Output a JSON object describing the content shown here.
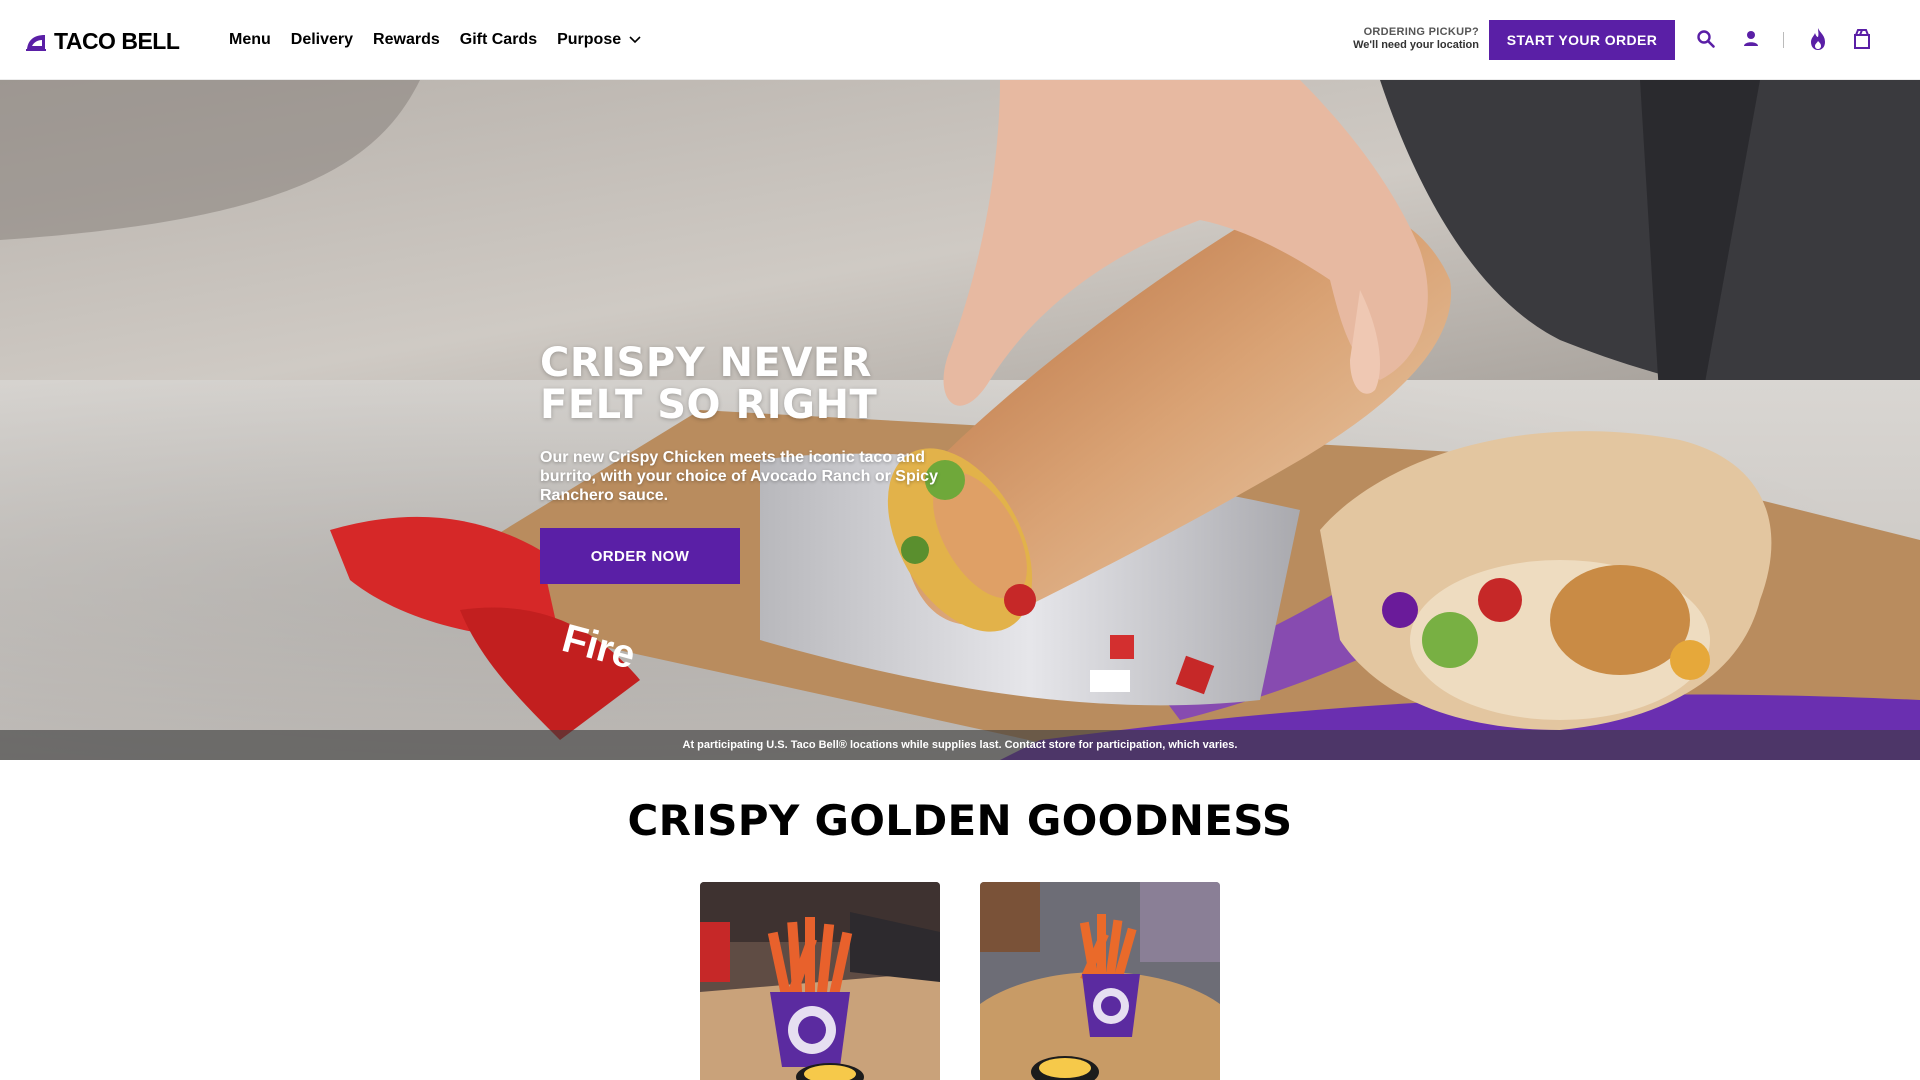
{
  "header": {
    "logo_text": "TACO BELL",
    "nav": [
      {
        "label": "Menu"
      },
      {
        "label": "Delivery"
      },
      {
        "label": "Rewards"
      },
      {
        "label": "Gift Cards"
      },
      {
        "label": "Purpose"
      }
    ],
    "pickup_title": "ORDERING PICKUP?",
    "pickup_sub": "We'll need your location",
    "start_order_label": "START YOUR ORDER",
    "icons": [
      "search-icon",
      "account-icon",
      "fire-icon",
      "bag-icon"
    ]
  },
  "hero": {
    "title": "CRISPY NEVER FELT SO RIGHT",
    "description": "Our new Crispy Chicken meets the iconic taco and burrito, with your choice of Avocado Ranch or Spicy Ranchero sauce.",
    "cta_label": "ORDER NOW",
    "disclaimer": "At participating U.S. Taco Bell® locations while supplies last. Contact store for participation, which varies."
  },
  "section": {
    "title": "CRISPY GOLDEN GOODNESS",
    "cards": [
      {
        "name": "fries-card-1"
      },
      {
        "name": "fries-card-2"
      }
    ]
  },
  "colors": {
    "brand_purple": "#5a1fa6",
    "text": "#000000",
    "background": "#ffffff"
  }
}
